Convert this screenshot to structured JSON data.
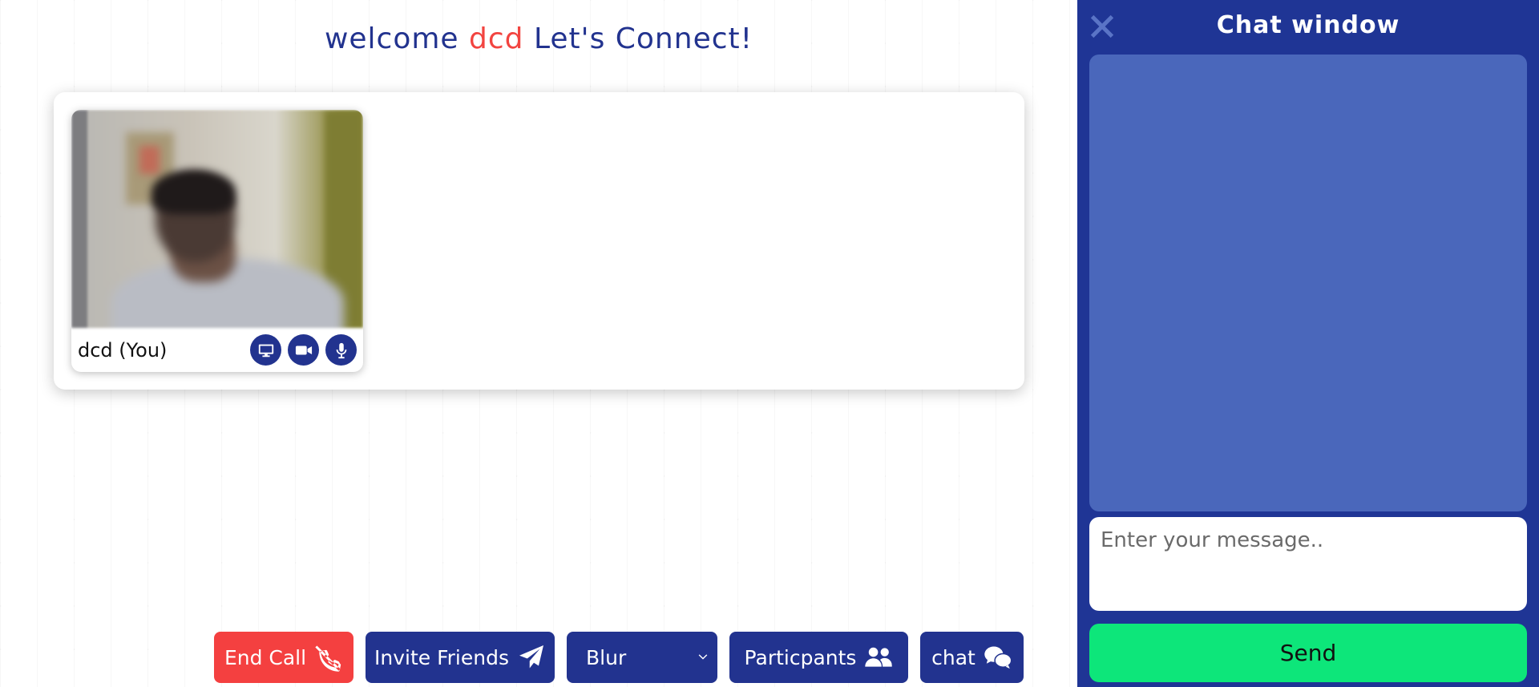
{
  "header": {
    "welcome_prefix": "welcome",
    "username": "dcd",
    "welcome_suffix": "Let's Connect!"
  },
  "video_tile": {
    "name": "dcd (You)"
  },
  "toolbar": {
    "end_call_label": "End Call",
    "invite_label": "Invite Friends",
    "blur_selected": "Blur",
    "participants_label": "Particpants",
    "chat_label": "chat"
  },
  "chat": {
    "title": "Chat window",
    "placeholder": "Enter your message..",
    "send_label": "Send"
  },
  "colors": {
    "primary": "#22338f",
    "danger": "#f44040",
    "chat_bg": "#1f3595",
    "chat_messages_bg": "#4a67bb",
    "send": "#0de67a"
  }
}
